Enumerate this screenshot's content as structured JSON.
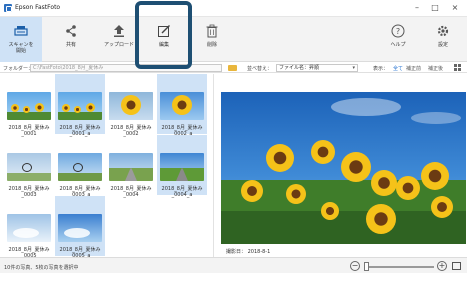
{
  "app": {
    "title": "Epson FastFoto"
  },
  "window": {
    "minimize": "–",
    "maximize": "□",
    "close": "×"
  },
  "toolbar": {
    "scan": "スキャンを\n開始",
    "share": "共有",
    "upload": "アップロード",
    "edit": "編集",
    "delete": "削除",
    "help": "ヘルプ",
    "settings": "設定"
  },
  "folderbar": {
    "folder_label": "フォルダー：",
    "folder_path": "C:\\FastFoto\\2018_8月_夏休み",
    "sort_label": "並べ替え：",
    "sort_value": "ファイル名：昇順",
    "display_label": "表示：",
    "filters": [
      "全て",
      "補正前",
      "補正後"
    ],
    "active_filter": "全て"
  },
  "thumbnails": [
    {
      "caption": "2018_8月_夏休み\n_0001",
      "selected": false
    },
    {
      "caption": "2018_8月_夏休み\n_0001_a",
      "selected": true
    },
    {
      "caption": "2018_8月_夏休み\n_0002",
      "selected": false
    },
    {
      "caption": "2018_8月_夏休み\n_0002_a",
      "selected": true
    },
    {
      "caption": "2018_8月_夏休み\n_0003",
      "selected": false
    },
    {
      "caption": "2018_8月_夏休み\n_0003_a",
      "selected": false
    },
    {
      "caption": "2018_8月_夏休み\n_0004",
      "selected": false
    },
    {
      "caption": "2018_8月_夏休み\n_0004_a",
      "selected": true
    },
    {
      "caption": "2018_8月_夏休み\n_0005",
      "selected": false
    },
    {
      "caption": "2018_8月_夏休み\n_0005_a",
      "selected": true
    }
  ],
  "preview": {
    "shot_date": "撮影日： 2018-8-1"
  },
  "status": {
    "text": "10件の写真、5枚の写真を選択中",
    "zoom_level": 0.0
  },
  "colors": {
    "selection": "#cfe2f6",
    "highlight_border": "#1e4f73",
    "accent": "#1f6fd0"
  },
  "icons": {
    "scan": "scanner-icon",
    "share": "share-icon",
    "upload": "upload-icon",
    "edit": "edit-icon",
    "delete": "trash-icon",
    "help": "help-icon",
    "settings": "gear-icon"
  }
}
